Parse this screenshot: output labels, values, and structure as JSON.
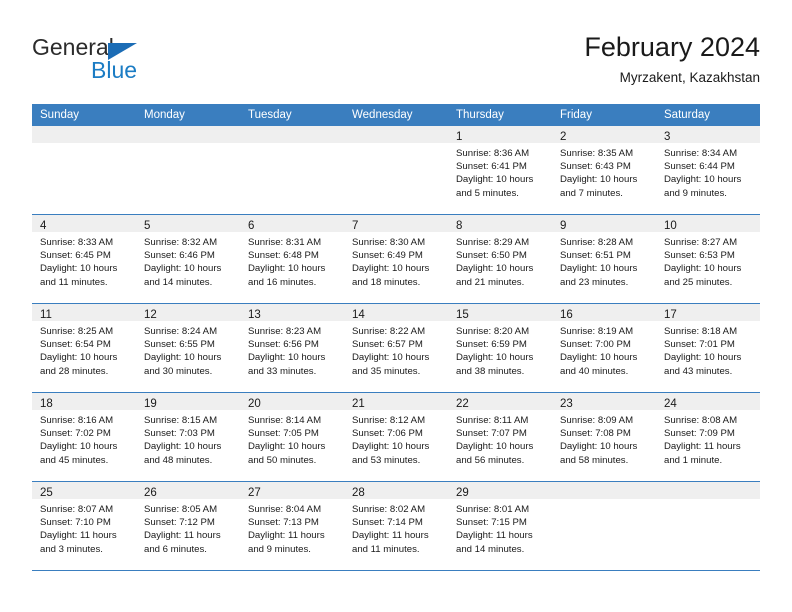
{
  "brand": {
    "word1": "General",
    "word2": "Blue",
    "triangle_color": "#1b6cb5",
    "blue_color": "#1b7cc4"
  },
  "header": {
    "title": "February 2024",
    "subtitle": "Myrzakent, Kazakhstan"
  },
  "theme": {
    "header_bg": "#3a7ebf",
    "daynum_band_bg": "#efefef",
    "divider": "#3a7ebf",
    "text": "#1a1a1a"
  },
  "weekdays": [
    "Sunday",
    "Monday",
    "Tuesday",
    "Wednesday",
    "Thursday",
    "Friday",
    "Saturday"
  ],
  "labels": {
    "sunrise_prefix": "Sunrise:",
    "sunset_prefix": "Sunset:",
    "daylight_prefix": "Daylight:"
  },
  "weeks": [
    [
      {
        "day": ""
      },
      {
        "day": ""
      },
      {
        "day": ""
      },
      {
        "day": ""
      },
      {
        "day": "1",
        "sunrise": "Sunrise: 8:36 AM",
        "sunset": "Sunset: 6:41 PM",
        "daylight1": "Daylight: 10 hours",
        "daylight2": "and 5 minutes."
      },
      {
        "day": "2",
        "sunrise": "Sunrise: 8:35 AM",
        "sunset": "Sunset: 6:43 PM",
        "daylight1": "Daylight: 10 hours",
        "daylight2": "and 7 minutes."
      },
      {
        "day": "3",
        "sunrise": "Sunrise: 8:34 AM",
        "sunset": "Sunset: 6:44 PM",
        "daylight1": "Daylight: 10 hours",
        "daylight2": "and 9 minutes."
      }
    ],
    [
      {
        "day": "4",
        "sunrise": "Sunrise: 8:33 AM",
        "sunset": "Sunset: 6:45 PM",
        "daylight1": "Daylight: 10 hours",
        "daylight2": "and 11 minutes."
      },
      {
        "day": "5",
        "sunrise": "Sunrise: 8:32 AM",
        "sunset": "Sunset: 6:46 PM",
        "daylight1": "Daylight: 10 hours",
        "daylight2": "and 14 minutes."
      },
      {
        "day": "6",
        "sunrise": "Sunrise: 8:31 AM",
        "sunset": "Sunset: 6:48 PM",
        "daylight1": "Daylight: 10 hours",
        "daylight2": "and 16 minutes."
      },
      {
        "day": "7",
        "sunrise": "Sunrise: 8:30 AM",
        "sunset": "Sunset: 6:49 PM",
        "daylight1": "Daylight: 10 hours",
        "daylight2": "and 18 minutes."
      },
      {
        "day": "8",
        "sunrise": "Sunrise: 8:29 AM",
        "sunset": "Sunset: 6:50 PM",
        "daylight1": "Daylight: 10 hours",
        "daylight2": "and 21 minutes."
      },
      {
        "day": "9",
        "sunrise": "Sunrise: 8:28 AM",
        "sunset": "Sunset: 6:51 PM",
        "daylight1": "Daylight: 10 hours",
        "daylight2": "and 23 minutes."
      },
      {
        "day": "10",
        "sunrise": "Sunrise: 8:27 AM",
        "sunset": "Sunset: 6:53 PM",
        "daylight1": "Daylight: 10 hours",
        "daylight2": "and 25 minutes."
      }
    ],
    [
      {
        "day": "11",
        "sunrise": "Sunrise: 8:25 AM",
        "sunset": "Sunset: 6:54 PM",
        "daylight1": "Daylight: 10 hours",
        "daylight2": "and 28 minutes."
      },
      {
        "day": "12",
        "sunrise": "Sunrise: 8:24 AM",
        "sunset": "Sunset: 6:55 PM",
        "daylight1": "Daylight: 10 hours",
        "daylight2": "and 30 minutes."
      },
      {
        "day": "13",
        "sunrise": "Sunrise: 8:23 AM",
        "sunset": "Sunset: 6:56 PM",
        "daylight1": "Daylight: 10 hours",
        "daylight2": "and 33 minutes."
      },
      {
        "day": "14",
        "sunrise": "Sunrise: 8:22 AM",
        "sunset": "Sunset: 6:57 PM",
        "daylight1": "Daylight: 10 hours",
        "daylight2": "and 35 minutes."
      },
      {
        "day": "15",
        "sunrise": "Sunrise: 8:20 AM",
        "sunset": "Sunset: 6:59 PM",
        "daylight1": "Daylight: 10 hours",
        "daylight2": "and 38 minutes."
      },
      {
        "day": "16",
        "sunrise": "Sunrise: 8:19 AM",
        "sunset": "Sunset: 7:00 PM",
        "daylight1": "Daylight: 10 hours",
        "daylight2": "and 40 minutes."
      },
      {
        "day": "17",
        "sunrise": "Sunrise: 8:18 AM",
        "sunset": "Sunset: 7:01 PM",
        "daylight1": "Daylight: 10 hours",
        "daylight2": "and 43 minutes."
      }
    ],
    [
      {
        "day": "18",
        "sunrise": "Sunrise: 8:16 AM",
        "sunset": "Sunset: 7:02 PM",
        "daylight1": "Daylight: 10 hours",
        "daylight2": "and 45 minutes."
      },
      {
        "day": "19",
        "sunrise": "Sunrise: 8:15 AM",
        "sunset": "Sunset: 7:03 PM",
        "daylight1": "Daylight: 10 hours",
        "daylight2": "and 48 minutes."
      },
      {
        "day": "20",
        "sunrise": "Sunrise: 8:14 AM",
        "sunset": "Sunset: 7:05 PM",
        "daylight1": "Daylight: 10 hours",
        "daylight2": "and 50 minutes."
      },
      {
        "day": "21",
        "sunrise": "Sunrise: 8:12 AM",
        "sunset": "Sunset: 7:06 PM",
        "daylight1": "Daylight: 10 hours",
        "daylight2": "and 53 minutes."
      },
      {
        "day": "22",
        "sunrise": "Sunrise: 8:11 AM",
        "sunset": "Sunset: 7:07 PM",
        "daylight1": "Daylight: 10 hours",
        "daylight2": "and 56 minutes."
      },
      {
        "day": "23",
        "sunrise": "Sunrise: 8:09 AM",
        "sunset": "Sunset: 7:08 PM",
        "daylight1": "Daylight: 10 hours",
        "daylight2": "and 58 minutes."
      },
      {
        "day": "24",
        "sunrise": "Sunrise: 8:08 AM",
        "sunset": "Sunset: 7:09 PM",
        "daylight1": "Daylight: 11 hours",
        "daylight2": "and 1 minute."
      }
    ],
    [
      {
        "day": "25",
        "sunrise": "Sunrise: 8:07 AM",
        "sunset": "Sunset: 7:10 PM",
        "daylight1": "Daylight: 11 hours",
        "daylight2": "and 3 minutes."
      },
      {
        "day": "26",
        "sunrise": "Sunrise: 8:05 AM",
        "sunset": "Sunset: 7:12 PM",
        "daylight1": "Daylight: 11 hours",
        "daylight2": "and 6 minutes."
      },
      {
        "day": "27",
        "sunrise": "Sunrise: 8:04 AM",
        "sunset": "Sunset: 7:13 PM",
        "daylight1": "Daylight: 11 hours",
        "daylight2": "and 9 minutes."
      },
      {
        "day": "28",
        "sunrise": "Sunrise: 8:02 AM",
        "sunset": "Sunset: 7:14 PM",
        "daylight1": "Daylight: 11 hours",
        "daylight2": "and 11 minutes."
      },
      {
        "day": "29",
        "sunrise": "Sunrise: 8:01 AM",
        "sunset": "Sunset: 7:15 PM",
        "daylight1": "Daylight: 11 hours",
        "daylight2": "and 14 minutes."
      },
      {
        "day": ""
      },
      {
        "day": ""
      }
    ]
  ]
}
